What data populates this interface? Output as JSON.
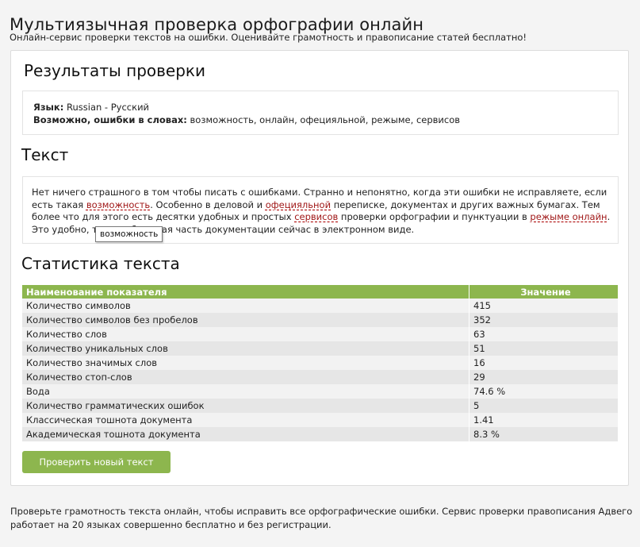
{
  "page": {
    "title": "Мультиязычная проверка орфографии онлайн",
    "subtitle": "Онлайн-сервис проверки текстов на ошибки. Оценивайте грамотность и правописание статей бесплатно!"
  },
  "results": {
    "heading": "Результаты проверки",
    "language_label": "Язык:",
    "language_value": "Russian - Русский",
    "errors_label": "Возможно, ошибки в словах:",
    "errors_value": "возможность, онлайн, офецияльной, режыме, сервисов"
  },
  "text_section": {
    "heading": "Текст",
    "segments": [
      {
        "t": "Нет ничего страшного в том чтобы писать с ошибками. Странно и непонятно, когда эти ошибки не исправляете, если есть такая "
      },
      {
        "t": "возможность",
        "err": true
      },
      {
        "t": ". Особенно в деловой и "
      },
      {
        "t": "офецияльной",
        "err": true
      },
      {
        "t": " переписке, документах и других важных бумагах. Тем более что для этого есть десятки удобных и простых "
      },
      {
        "t": "сервисов",
        "err": true
      },
      {
        "t": " проверки орфографии и пунктуации в "
      },
      {
        "t": "режыме онлайн",
        "err": true
      },
      {
        "t": ". Это удобно, так как большая часть документации сейчас в электронном виде."
      }
    ],
    "tooltip": "возможность"
  },
  "stats": {
    "heading": "Статистика текста",
    "columns": [
      "Наименование показателя",
      "Значение"
    ],
    "rows": [
      [
        "Количество символов",
        "415"
      ],
      [
        "Количество символов без пробелов",
        "352"
      ],
      [
        "Количество слов",
        "63"
      ],
      [
        "Количество уникальных слов",
        "51"
      ],
      [
        "Количество значимых слов",
        "16"
      ],
      [
        "Количество стоп-слов",
        "29"
      ],
      [
        "Вода",
        "74.6 %"
      ],
      [
        "Количество грамматических ошибок",
        "5"
      ],
      [
        "Классическая тошнота документа",
        "1.41"
      ],
      [
        "Академическая тошнота документа",
        "8.3 %"
      ]
    ]
  },
  "actions": {
    "check_new_label": "Проверить новый текст"
  },
  "footer": {
    "text": "Проверьте грамотность текста онлайн, чтобы исправить все орфографические ошибки. Сервис проверки правописания Адвего работает на 20 языках совершенно бесплатно и без регистрации."
  },
  "colors": {
    "accent_green": "#8db64e",
    "error_red": "#a01818"
  }
}
